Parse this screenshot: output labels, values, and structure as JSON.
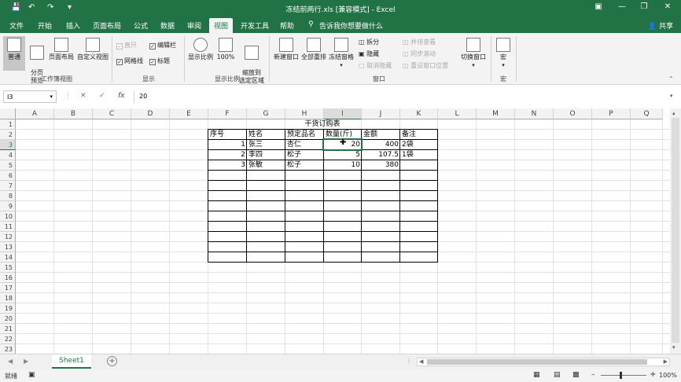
{
  "titlebar": {
    "title": "冻结前两行.xls  [兼容模式]  -  Excel",
    "save_icon": "save-icon",
    "undo_icon": "undo-icon",
    "redo_icon": "redo-icon"
  },
  "tabs": [
    "文件",
    "开始",
    "插入",
    "页面布局",
    "公式",
    "数据",
    "审阅",
    "视图",
    "开发工具",
    "帮助"
  ],
  "active_tab": "视图",
  "tell_me": "告诉我你想要做什么",
  "share": "共享",
  "ribbon": {
    "groups": {
      "workbook_views": "工作簿视图",
      "show": "显示",
      "zoom": "显示比例",
      "window": "窗口",
      "macros": "宏"
    },
    "normal": "普通",
    "page_break": "分页\n预览",
    "page_layout": "页面布局",
    "custom_views": "自定义视图",
    "ruler": "直尺",
    "formula_bar": "编辑栏",
    "gridlines": "网格线",
    "headings": "标题",
    "zoom": "显示比例",
    "zoom100": "100%",
    "zoom_selection": "缩放到\n选定区域",
    "new_window": "新建窗口",
    "arrange_all": "全部重排",
    "freeze_panes": "冻结窗格",
    "split": "拆分",
    "hide": "隐藏",
    "unhide": "取消隐藏",
    "view_side": "并排查看",
    "sync_scroll": "同步滚动",
    "reset_pos": "重设窗口位置",
    "switch_windows": "切换窗口",
    "macros": "宏"
  },
  "formula_bar": {
    "name_box": "I3",
    "value": "20"
  },
  "columns": [
    "A",
    "B",
    "C",
    "D",
    "E",
    "F",
    "G",
    "H",
    "I",
    "J",
    "K",
    "L",
    "M",
    "N",
    "O",
    "P",
    "Q"
  ],
  "rows": [
    "1",
    "2",
    "3",
    "4",
    "5",
    "6",
    "7",
    "8",
    "9",
    "10",
    "11",
    "12",
    "13",
    "14",
    "15",
    "16",
    "17",
    "18",
    "19",
    "20",
    "21",
    "22",
    "23"
  ],
  "selected": {
    "col": "I",
    "row": "3"
  },
  "sheet_table": {
    "title": "干货订购表",
    "headers": [
      "序号",
      "姓名",
      "预定品名",
      "数量(斤)",
      "金额",
      "备注"
    ],
    "rows": [
      [
        "1",
        "张三",
        "杏仁",
        "20",
        "400",
        "2袋"
      ],
      [
        "2",
        "李四",
        "松子",
        "5",
        "107.5",
        "1袋"
      ],
      [
        "3",
        "张敏",
        "松子",
        "10",
        "380",
        ""
      ]
    ]
  },
  "sheet_tab": "Sheet1",
  "status": {
    "ready": "就绪",
    "zoom": "100%"
  }
}
